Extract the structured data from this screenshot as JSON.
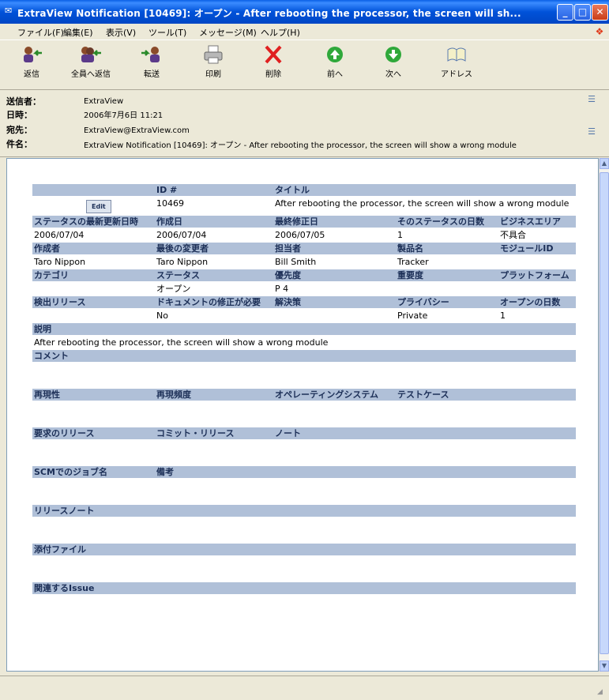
{
  "window": {
    "title": "ExtraView Notification [10469]: オープン - After rebooting the processor, the screen will sh..."
  },
  "menu": [
    "ファイル(F)",
    "編集(E)",
    "表示(V)",
    "ツール(T)",
    "メッセージ(M)",
    "ヘルプ(H)"
  ],
  "toolbar": {
    "reply": "返信",
    "reply_all": "全員へ返信",
    "forward": "転送",
    "print": "印刷",
    "delete": "削除",
    "previous": "前へ",
    "next": "次へ",
    "address": "アドレス"
  },
  "header": {
    "from_label": "送信者：",
    "from": "ExtraView",
    "date_label": "日時：",
    "date": "2006年7月6日 11:21",
    "to_label": "宛先：",
    "to": "ExtraView@ExtraView.com",
    "subject_label": "件名：",
    "subject": "ExtraView Notification [10469]: オープン - After rebooting the processor, the screen will show a wrong module"
  },
  "issue": {
    "edit_label": "Edit",
    "id_header": "ID #",
    "id": "10469",
    "title_header": "タイトル",
    "title": "After rebooting the processor, the screen will show a wrong module",
    "status_changed_header": "ステータスの最新更新日時",
    "status_changed": "2006/07/04",
    "created_header": "作成日",
    "created": "2006/07/04",
    "modified_header": "最終修正日",
    "modified": "2006/07/05",
    "status_days_header": "そのステータスの日数",
    "status_days": "1",
    "business_area_header": "ビジネスエリア",
    "business_area": "不具合",
    "originator_header": "作成者",
    "originator": "Taro Nippon",
    "last_changed_by_header": "最後の変更者",
    "last_changed_by": "Taro Nippon",
    "assigned_header": "担当者",
    "assigned": "Bill Smith",
    "product_header": "製品名",
    "product": "Tracker",
    "module_header": "モジュールID",
    "category_header": "カテゴリ",
    "status_header": "ステータス",
    "status": "オープン",
    "priority_header": "優先度",
    "priority": "P 4",
    "severity_header": "重要度",
    "platform_header": "プラットフォーム",
    "found_release_header": "検出リリース",
    "doc_change_header": "ドキュメントの修正が必要",
    "doc_change": "No",
    "resolution_header": "解決策",
    "privacy_header": "プライバシー",
    "privacy": "Private",
    "days_open_header": "オープンの日数",
    "days_open": "1",
    "description_header": "説明",
    "description": "After rebooting the processor, the screen will show a wrong module",
    "comments_header": "コメント",
    "repro_header": "再現性",
    "repro_freq_header": "再現頻度",
    "os_header": "オペレーティングシステム",
    "test_case_header": "テストケース",
    "requested_release_header": "要求のリリース",
    "committed_release_header": "コミット・リリース",
    "notes_header": "ノート",
    "scm_job_header": "SCMでのジョブ名",
    "remarks_header": "備考",
    "release_notes_header": "リリースノート",
    "attachments_header": "添付ファイル",
    "related_issue_header": "関連するIssue"
  },
  "colors": {
    "header_cell": "#b0c0d8",
    "modified": "#ff2a2a",
    "changed_by": "#ff2a2a",
    "assigned": "#2ec02e",
    "titlebar": "#0052d9"
  }
}
